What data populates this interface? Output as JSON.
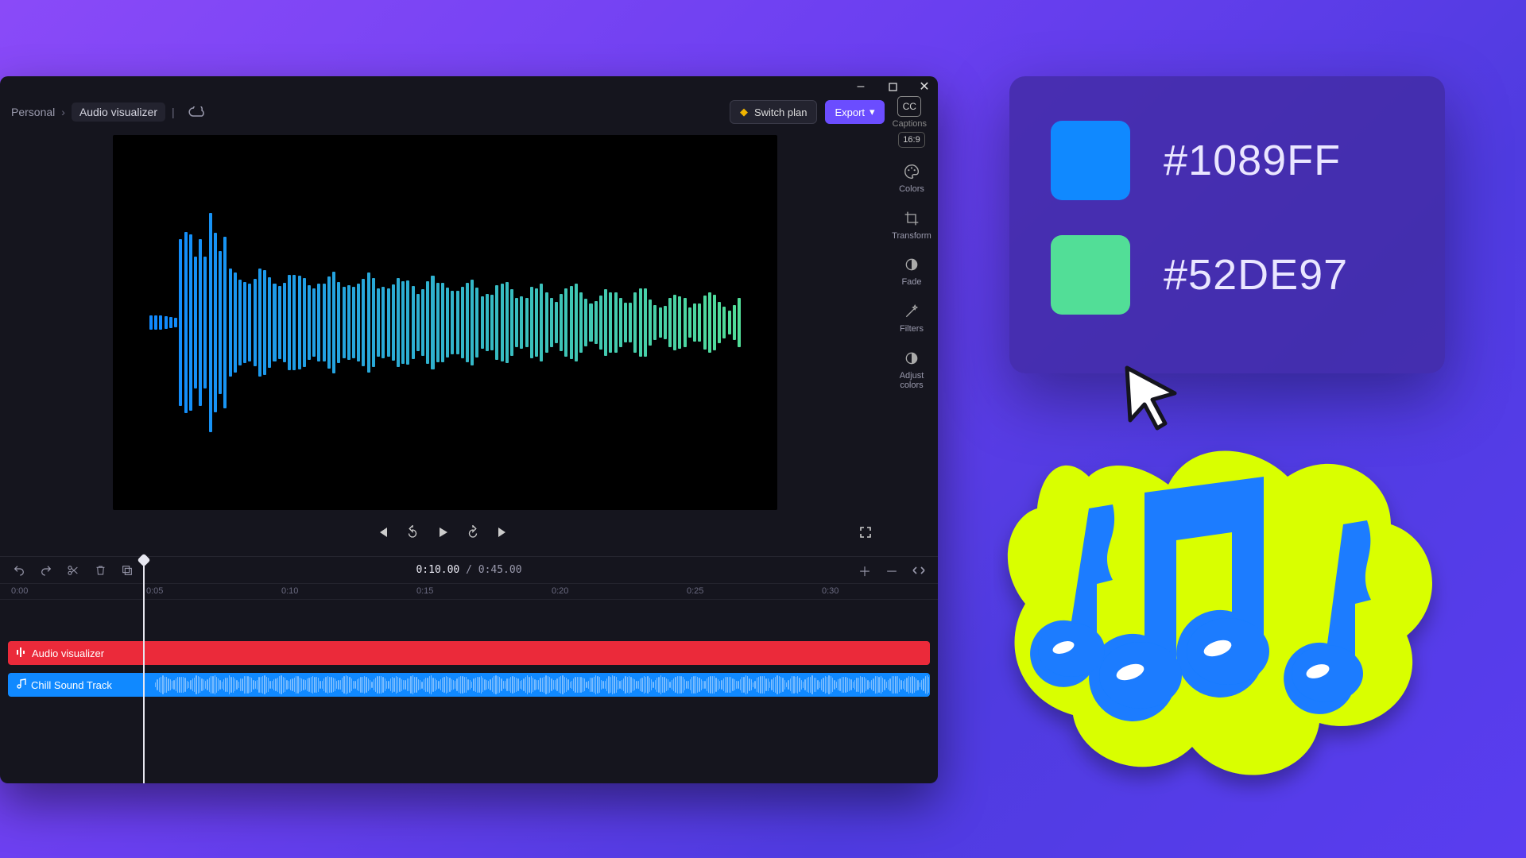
{
  "window": {
    "minimize": "–",
    "maximize": "□",
    "close": "✕"
  },
  "breadcrumbs": {
    "workspace": "Personal",
    "sep": "›",
    "project": "Audio visualizer"
  },
  "header": {
    "switch_plan": "Switch plan",
    "export": "Export",
    "cc": "CC",
    "captions_label": "Captions"
  },
  "aspect_ratio": "16:9",
  "props": {
    "colors": "Colors",
    "transform": "Transform",
    "fade": "Fade",
    "filters": "Filters",
    "adjust": "Adjust\ncolors"
  },
  "playback": {
    "current": "0:10.00",
    "sep": " / ",
    "total": "0:45.00"
  },
  "ruler": [
    "0:00",
    "0:05",
    "0:10",
    "0:15",
    "0:20",
    "0:25",
    "0:30"
  ],
  "tracks": {
    "visualizer": "Audio visualizer",
    "audio": "Chill Sound Track"
  },
  "colors_card": {
    "c1_hex": "#1089FF",
    "c2_hex": "#52DE97"
  }
}
